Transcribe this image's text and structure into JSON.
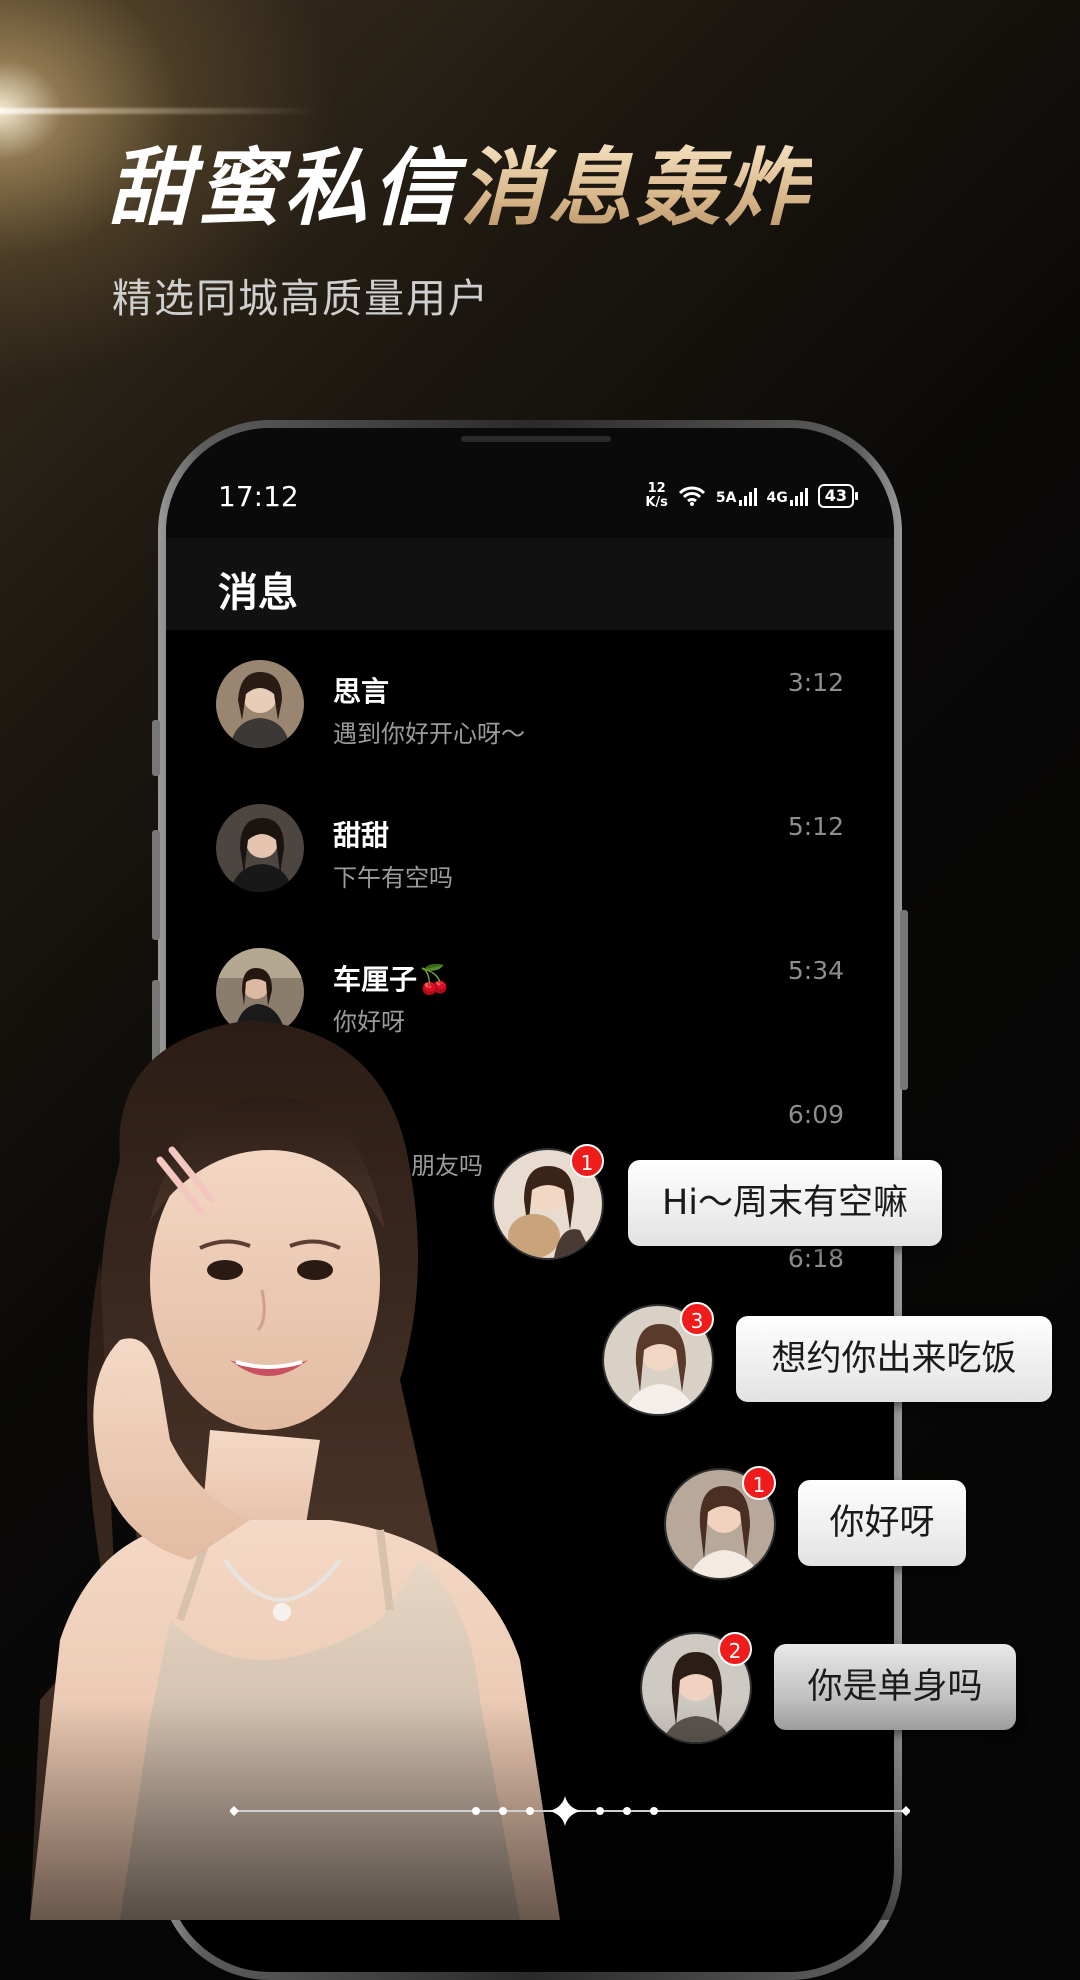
{
  "headline": {
    "white": "甜蜜私信",
    "gold": "消息轰炸"
  },
  "subline": "精选同城高质量用户",
  "phone": {
    "status": {
      "time": "17:12",
      "net_speed_value": "12",
      "net_speed_unit": "K/s",
      "sim1": "5A",
      "sim2": "4G",
      "battery": "43"
    },
    "title": "消息",
    "messages": [
      {
        "name": "思言",
        "preview": "遇到你好开心呀～",
        "time": "3:12"
      },
      {
        "name": "甜甜",
        "preview": "下午有空吗",
        "time": "5:12"
      },
      {
        "name": "车厘子🍒",
        "preview": "你好呀",
        "time": "5:34"
      },
      {
        "name": "",
        "preview": "朋友吗",
        "time": "6:09"
      },
      {
        "name": "",
        "preview": "",
        "time": "6:18"
      }
    ]
  },
  "chats": [
    {
      "text": "Hi～周末有空嘛",
      "badge": "1"
    },
    {
      "text": "想约你出来吃饭",
      "badge": "3"
    },
    {
      "text": "你好呀",
      "badge": "1"
    },
    {
      "text": "你是单身吗",
      "badge": "2"
    }
  ],
  "pager": {
    "dots": 7,
    "active_index": 3
  },
  "colors": {
    "gold": "#d8b68a",
    "badge_red": "#f01b1b",
    "background": "#050505"
  }
}
